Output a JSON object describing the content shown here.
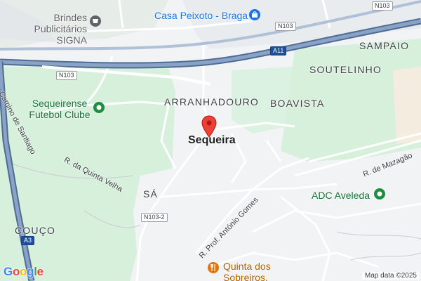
{
  "map": {
    "colors": {
      "land": "#f1f3f4",
      "park": "#d6f0dc",
      "sand": "#f3ecdf",
      "highway": "#6b86a8",
      "highway_core": "#8aa2c6",
      "minor_road": "#ffffff",
      "outline": "#c9cdd2",
      "poi_green": "#137333",
      "poi_blue": "#1a73e8",
      "poi_orange": "#e8710a",
      "pin": "#ea4335"
    },
    "places": {
      "arranhadouro": "ARRANHADOURO",
      "boavista": "BOAVISTA",
      "sampaio": "SAMPAIO",
      "soutelinho": "SOUTELINHO",
      "sa": "SÁ",
      "couco": "COUÇO"
    },
    "town": "Sequeira",
    "pois": {
      "brindes": "Brindes\nPublicitários SIGNA",
      "casa_peixoto": "Casa Peixoto - Braga",
      "sequeirense": "Sequeirense\nFutebol Clube",
      "adc_aveleda": "ADC Aveleda",
      "quinta": "Quinta dos\nSobreiros, Lda"
    },
    "streets": {
      "camino_santiago": "Camino de Santiago",
      "quinta_velha": "R. da Quinta Velha",
      "mazagao": "R. de Mazagão",
      "antonio_gomes": "R. Prof. António Gomes"
    },
    "shields": {
      "n103_top": "N103",
      "n103_mid": "N103",
      "n103_left": "N103",
      "a11": "A11",
      "n103_2": "N103-2",
      "a3": "A3"
    },
    "logo": "Google",
    "attribution": "Map data ©2025"
  }
}
